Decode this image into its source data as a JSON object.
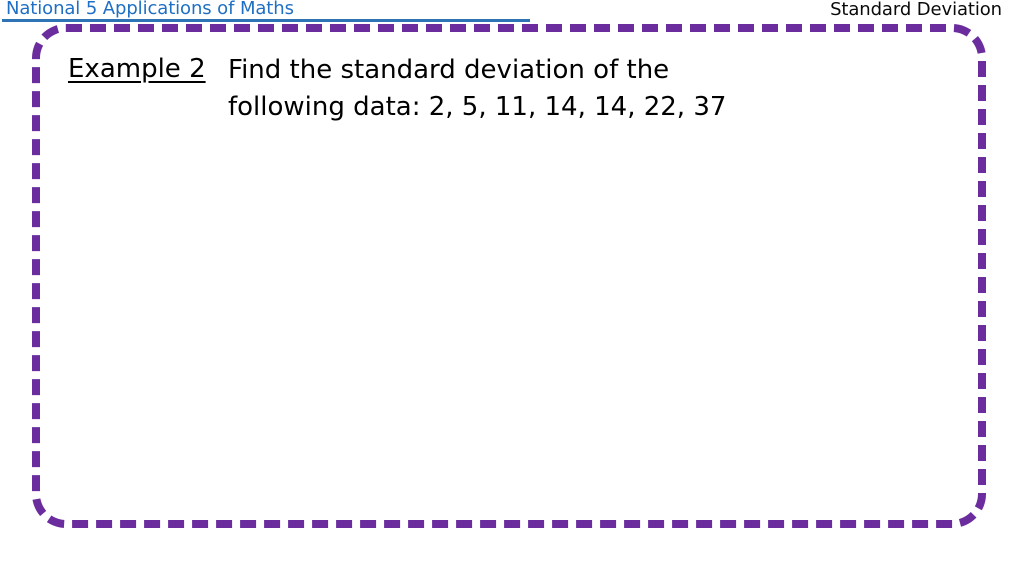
{
  "header": {
    "course_title": "National 5 Applications of Maths",
    "topic_title": "Standard Deviation",
    "course_title_color": "#1F6FC4",
    "rule_color": "#2E74B5",
    "topic_title_color": "#0A0A0A"
  },
  "frame": {
    "border_color": "#6B2D9E",
    "border_style": "dashed"
  },
  "slide": {
    "example_label": "Example 2",
    "question_line_1": "Find the standard deviation of the",
    "question_line_2": "following data: 2, 5, 11, 14, 14, 22, 37",
    "question_full": "Find the standard deviation of the following data: 2, 5, 11, 14, 14, 22, 37",
    "data_values": [
      2,
      5,
      11,
      14,
      14,
      22,
      37
    ],
    "text_color": "#000000"
  }
}
